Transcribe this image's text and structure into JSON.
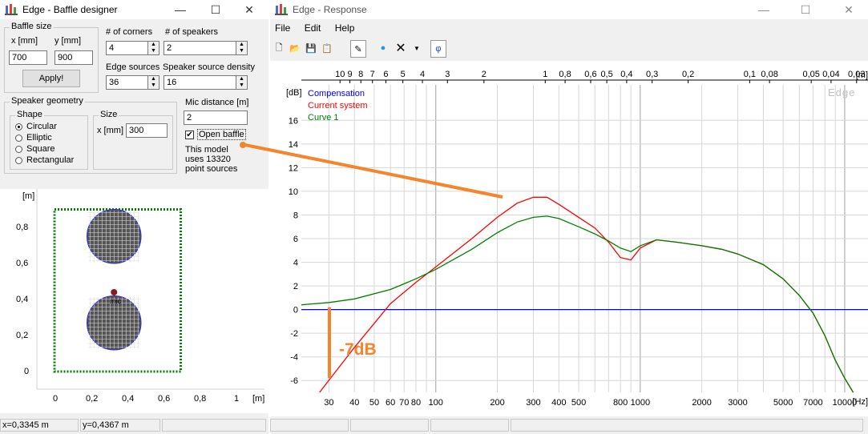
{
  "baffle_window": {
    "title": "Edge - Baffle designer",
    "buttons": {
      "minimize": "—",
      "maximize": "☐",
      "close": "✕"
    },
    "baffle_size": {
      "label": "Baffle size",
      "x_label": "x [mm]",
      "x_value": "700",
      "y_label": "y [mm]",
      "y_value": "900",
      "apply": "Apply!"
    },
    "corners": {
      "label": "# of corners",
      "value": "4"
    },
    "speakers": {
      "label": "# of speakers",
      "value": "2"
    },
    "edge_sources": {
      "label": "Edge sources",
      "value": "36"
    },
    "source_density": {
      "label": "Speaker source density",
      "value": "16"
    },
    "geometry": {
      "label": "Speaker geometry",
      "shape_label": "Shape",
      "shapes": [
        "Circular",
        "Elliptic",
        "Square",
        "Rectangular"
      ],
      "selected": "Circular",
      "size_label": "Size",
      "size_x_label": "x [mm]",
      "size_x_value": "300"
    },
    "mic_distance": {
      "label": "Mic distance [m]",
      "value": "2"
    },
    "open_baffle": {
      "label": "Open baffle",
      "checked": true
    },
    "model_info": "This model uses 13320 point sources",
    "plot": {
      "unit": "[m]",
      "y_ticks": [
        "0,8",
        "0,6",
        "0,4",
        "0,2",
        "0"
      ],
      "x_ticks": [
        "0",
        "0,2",
        "0,4",
        "0,6",
        "0,8",
        "1"
      ],
      "x_unit": "[m]",
      "mic_label": "mic"
    },
    "status": {
      "x": "x=0,3345 m",
      "y": "y=0,4367 m"
    }
  },
  "response_window": {
    "title": "Edge - Response",
    "buttons": {
      "minimize": "—",
      "maximize": "☐",
      "close": "✕"
    },
    "menu": [
      "File",
      "Edit",
      "Help"
    ],
    "toolbar_icons": [
      "new-file-icon",
      "open-folder-icon",
      "save-icon",
      "copy-icon",
      "pen-icon",
      "speaker-icon",
      "delete-icon",
      "dropdown-icon",
      "phi-icon"
    ],
    "phi": "φ",
    "watermark": "Edge",
    "annotation": "-7dB",
    "colors": {
      "compensation": "#0000ff",
      "current": "#ff0000",
      "curve1": "#008000",
      "annotation": "#f5842a"
    },
    "chart_data": {
      "type": "line",
      "ylabel": "[dB]",
      "xlabel": "[Hz]",
      "top_label": "[m]",
      "xscale": "log",
      "xlim": [
        22,
        13000
      ],
      "ylim": [
        -7,
        19
      ],
      "grid": true,
      "legend_position": "top-left",
      "x_ticks": [
        30,
        40,
        50,
        60,
        70,
        80,
        100,
        200,
        300,
        400,
        500,
        800,
        1000,
        2000,
        3000,
        5000,
        7000,
        10000
      ],
      "x_tick_labels": [
        "30",
        "40",
        "50",
        "60",
        "70",
        "80",
        "100",
        "200",
        "300",
        "400",
        "500",
        "800",
        "1000",
        "2000",
        "3000",
        "5000",
        "7000",
        "10000"
      ],
      "y_ticks": [
        -6,
        -4,
        -2,
        0,
        2,
        4,
        6,
        8,
        10,
        12,
        14,
        16
      ],
      "y_tick_labels": [
        "-6",
        "-4",
        "-2",
        "0",
        "2",
        "4",
        "6",
        "8",
        "10",
        "12",
        "14",
        "16"
      ],
      "top_ticks": [
        "10",
        "9",
        "8",
        "7",
        "6",
        "5",
        "4",
        "3",
        "2",
        "1",
        "0,8",
        "0,6",
        "0,5",
        "0,4",
        "0,3",
        "0,2",
        "0,1",
        "0,08",
        "0,05",
        "0,04",
        "0,03"
      ],
      "top_tick_freqs": [
        34,
        38,
        43,
        49,
        57,
        69,
        86,
        114,
        172,
        343,
        429,
        572,
        686,
        858,
        1143,
        1715,
        3430,
        4288,
        6860,
        8575,
        11433
      ],
      "series": [
        {
          "name": "Compensation",
          "x": [
            22,
            13000
          ],
          "y": [
            0,
            0
          ]
        },
        {
          "name": "Current system",
          "x": [
            27,
            40,
            60,
            80,
            100,
            150,
            200,
            250,
            300,
            350,
            400,
            500,
            600,
            700,
            800,
            900,
            1000,
            1200,
            1500,
            2000,
            2500,
            3000,
            4000,
            5000,
            6000,
            7000,
            8000,
            9000,
            10000,
            11000
          ],
          "y": [
            -7,
            -3.2,
            0.5,
            2.3,
            3.6,
            6,
            7.8,
            9,
            9.5,
            9.5,
            8.9,
            7.8,
            6.9,
            5.7,
            4.4,
            4.2,
            5.2,
            5.9,
            5.7,
            5.4,
            5.1,
            4.7,
            3.8,
            2.6,
            1.2,
            -0.3,
            -2.2,
            -4.3,
            -5.8,
            -7
          ]
        },
        {
          "name": "Curve 1",
          "x": [
            22,
            30,
            40,
            60,
            80,
            100,
            150,
            200,
            250,
            300,
            350,
            400,
            500,
            600,
            700,
            800,
            900,
            1000,
            1200,
            1500,
            2000,
            2500,
            3000,
            4000,
            5000,
            6000,
            7000,
            8000,
            9000,
            10000,
            11000
          ],
          "y": [
            0.4,
            0.6,
            0.9,
            1.7,
            2.6,
            3.4,
            5.1,
            6.5,
            7.4,
            7.8,
            7.9,
            7.7,
            7.0,
            6.4,
            5.8,
            5.2,
            4.9,
            5.4,
            5.9,
            5.7,
            5.4,
            5.1,
            4.7,
            3.8,
            2.6,
            1.2,
            -0.3,
            -2.2,
            -4.3,
            -5.8,
            -7
          ]
        }
      ]
    },
    "status_cells": [
      "",
      "",
      "",
      ""
    ]
  }
}
